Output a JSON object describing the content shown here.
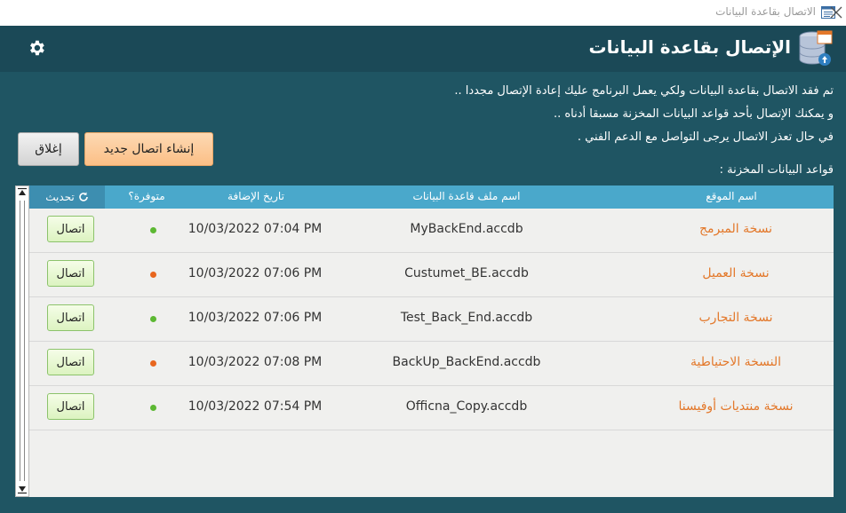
{
  "window": {
    "title": "الاتصال بقاعدة البيانات"
  },
  "header": {
    "title": "الإتصال بقاعدة البيانات"
  },
  "messages": [
    "تم فقد الاتصال بقاعدة البيانات ولكي يعمل البرنامج عليك إعادة الإتصال مجددا ..",
    "و يمكنك الإتصال بأحد قواعد البيانات المخزنة مسبقا أدناه ..",
    "في حال تعذر الاتصال يرجى التواصل مع الدعم الفني ."
  ],
  "buttons": {
    "new_connection": "إنشاء اتصال جديد",
    "close": "إغلاق",
    "connect": "اتصال"
  },
  "stored_label": "قواعد البيانات المخزنة :",
  "table": {
    "headers": {
      "site": "اسم الموقع",
      "file": "اسم ملف قاعدة البيانات",
      "date": "تاريخ الإضافة",
      "available": "متوفرة؟",
      "refresh": "تحديث"
    },
    "rows": [
      {
        "site": "نسخة المبرمج",
        "file": "MyBackEnd.accdb",
        "date": "10/03/2022 07:04 PM",
        "status": "available",
        "status_color": "#5cb832"
      },
      {
        "site": "نسخة العميل",
        "file": "Custumet_BE.accdb",
        "date": "10/03/2022 07:06 PM",
        "status": "unavailable",
        "status_color": "#e8661e"
      },
      {
        "site": "نسخة التجارب",
        "file": "Test_Back_End.accdb",
        "date": "10/03/2022 07:06 PM",
        "status": "available",
        "status_color": "#5cb832"
      },
      {
        "site": "النسخة الاحتياطية",
        "file": "BackUp_BackEnd.accdb",
        "date": "10/03/2022 07:08 PM",
        "status": "unavailable",
        "status_color": "#e8661e"
      },
      {
        "site": "نسخة منتديات أوفيسنا",
        "file": "Officna_Copy.accdb",
        "date": "10/03/2022 07:54 PM",
        "status": "available",
        "status_color": "#5cb832"
      }
    ]
  },
  "colors": {
    "header_bg": "#1b4957",
    "body_bg": "#1f5563",
    "table_header": "#4aa8cb",
    "site_text": "#e3782a",
    "available": "#5cb832",
    "unavailable": "#e8661e"
  }
}
